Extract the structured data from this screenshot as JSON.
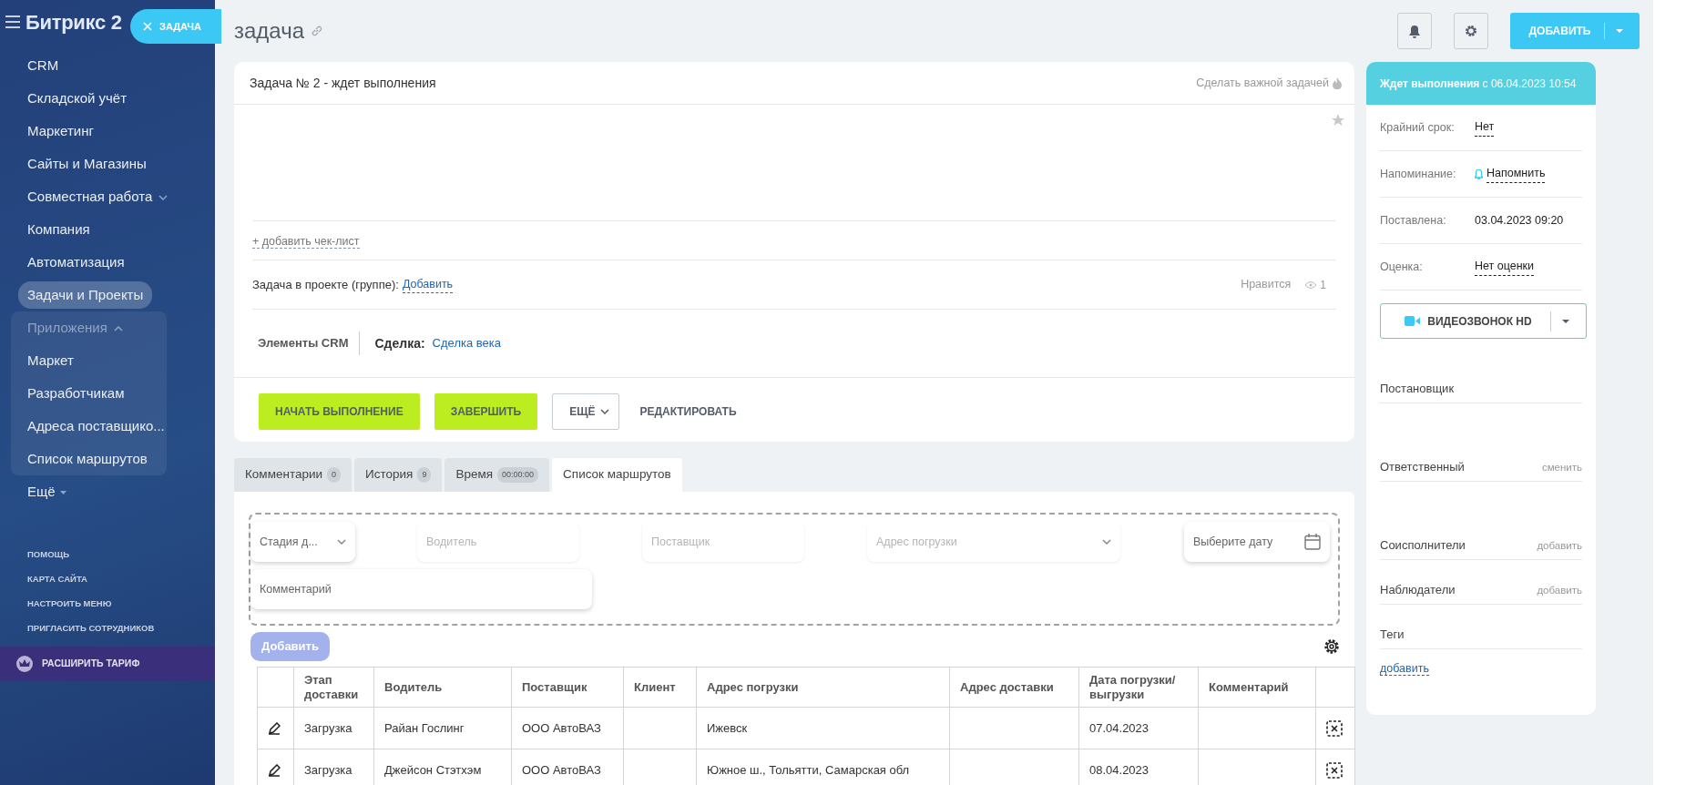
{
  "sidebar": {
    "logo": "Битрикс 2",
    "task_pill": "ЗАДАЧА",
    "items": [
      {
        "label": "CRM",
        "selected": false
      },
      {
        "label": "Складской учёт",
        "selected": false
      },
      {
        "label": "Маркетинг",
        "selected": false
      },
      {
        "label": "Сайты и Магазины",
        "selected": false
      },
      {
        "label": "Совместная работа",
        "selected": false,
        "expanded": false
      },
      {
        "label": "Компания",
        "selected": false
      },
      {
        "label": "Автоматизация",
        "selected": false
      },
      {
        "label": "Задачи и Проекты",
        "selected": true
      },
      {
        "label": "Приложения",
        "selected": false,
        "expanded": true,
        "children": [
          {
            "label": "Маркет",
            "selected": false
          },
          {
            "label": "Разработчикам",
            "selected": false
          },
          {
            "label": "Адреса поставщико...",
            "selected": false
          },
          {
            "label": "Список маршрутов",
            "selected": false
          }
        ]
      },
      {
        "label": "Ещё",
        "selected": false,
        "kind": "more"
      }
    ],
    "footer_links": [
      "ПОМОЩЬ",
      "КАРТА САЙТА",
      "НАСТРОИТЬ МЕНЮ",
      "ПРИГЛАСИТЬ СОТРУДНИКОВ"
    ],
    "upgrade": "РАСШИРИТЬ ТАРИФ"
  },
  "page_title": "задача",
  "toolbar": {
    "add_button": "ДОБАВИТЬ"
  },
  "task": {
    "title": "Задача № 2 - ждет выполнения",
    "make_important": "Сделать важной задачей",
    "add_checklist": "+ добавить чек-лист",
    "project_label": "Задача в проекте (группе):",
    "project_link": "Добавить",
    "likes": "Нравится",
    "views": "1",
    "crm_label": "Элементы CRM",
    "deal_label": "Сделка:",
    "deal_link": "Сделка века",
    "buttons": [
      {
        "label": "НАЧАТЬ ВЫПОЛНЕНИЕ",
        "kind": "primary"
      },
      {
        "label": "ЗАВЕРШИТЬ",
        "kind": "primary"
      },
      {
        "label": "ЕЩЁ",
        "kind": "dropdown"
      },
      {
        "label": "РЕДАКТИРОВАТЬ",
        "kind": "link"
      }
    ]
  },
  "tabs": [
    {
      "label": "Комментарии",
      "count": "0",
      "selected": false
    },
    {
      "label": "История",
      "count": "9",
      "selected": false
    },
    {
      "label": "Время",
      "count": "00:00:00",
      "selected": false
    },
    {
      "label": "Список маршрутов",
      "selected": true
    }
  ],
  "route_form": {
    "fields": [
      {
        "placeholder": "Стадия д...",
        "kind": "select"
      },
      {
        "placeholder": "Водитель",
        "kind": "text"
      },
      {
        "placeholder": "Поставщик",
        "kind": "text"
      },
      {
        "placeholder": "Адрес погрузки",
        "kind": "select"
      },
      {
        "placeholder": "Выберите дату",
        "kind": "date"
      },
      {
        "placeholder": "Комментарий",
        "kind": "wide"
      }
    ],
    "add_button": "Добавить"
  },
  "table": {
    "columns": [
      "",
      "Этап доставки",
      "Водитель",
      "Поставщик",
      "Клиент",
      "Адрес погрузки",
      "Адрес доставки",
      "Дата погрузки/ выгрузки",
      "Комментарий",
      ""
    ],
    "rows": [
      [
        "",
        "Загрузка",
        "Райан Гослинг",
        "ООО АвтоВАЗ",
        "",
        "Ижевск",
        "",
        "07.04.2023",
        "",
        ""
      ],
      [
        "",
        "Загрузка",
        "Джейсон Стэтхэм",
        "ООО АвтоВАЗ",
        "",
        "Южное ш., Тольятти, Самарская обл",
        "",
        "08.04.2023",
        "",
        ""
      ]
    ]
  },
  "status_panel": {
    "header": "**Ждет выполнения** с 06.04.2023 10:54",
    "fields": [
      {
        "label": "Крайний срок:",
        "value": "Нет",
        "kind": "link"
      },
      {
        "label": "Напоминание:",
        "value": "Напомнить",
        "kind": "remind"
      },
      {
        "label": "Поставлена:",
        "value": "03.04.2023 09:20",
        "kind": "plain"
      },
      {
        "label": "Оценка:",
        "value": "Нет оценки",
        "kind": "link"
      }
    ],
    "video_button": "ВИДЕОЗВОНОК HD",
    "roles": [
      {
        "label": "Постановщик"
      },
      {
        "label": "Ответственный",
        "action": "сменить"
      },
      {
        "label": "Соисполнители",
        "action": "добавить"
      },
      {
        "label": "Наблюдатели",
        "action": "добавить"
      },
      {
        "label": "Теги"
      }
    ],
    "tags_link": "добавить"
  }
}
